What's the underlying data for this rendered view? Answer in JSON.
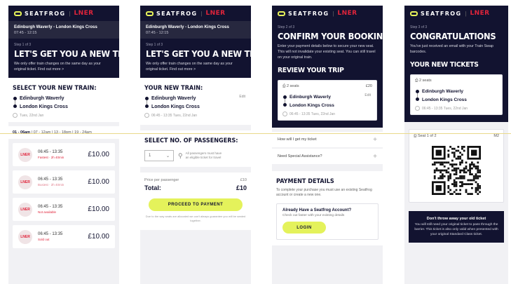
{
  "brand": {
    "name": "SEATFROG",
    "partner": "LNER"
  },
  "colors": {
    "navy": "#121330",
    "accent": "#e4f25b",
    "lner_red": "#e1243b"
  },
  "journey": {
    "route": "Edinburgh Waverly - London Kings Cross",
    "time": "07:45 - 12:15",
    "from": "Edinburgh Waverly",
    "to": "London Kings Cross",
    "date": "Tues, 22nd Jan"
  },
  "screen1": {
    "step": "Step 1 of 3",
    "title": "LET'S GET YOU A NEW TRAIN",
    "subtitle": "We only offer train changes on the same day as your original ticket. Find out more >",
    "select_heading": "SELECT YOUR NEW TRAIN:",
    "time_filters": {
      "active": "01 - 06am",
      "rest": "| 07 - 12am | 13 - 18pm | 19 - 24am"
    },
    "trains": [
      {
        "operator": "LNER",
        "time": "06:45 - 13:35",
        "status": "Fastest · 2h 40min",
        "price": "£10.00"
      },
      {
        "operator": "LNER",
        "time": "06:45 - 13:35",
        "status": "Busiest · 2h 40min",
        "price": "£10.00"
      },
      {
        "operator": "LNER",
        "time": "06:45 - 13:35",
        "status": "Not available",
        "price": "£10.00"
      },
      {
        "operator": "LNER",
        "time": "06:45 - 13:35",
        "status": "Sold out",
        "price": "£10.00"
      }
    ]
  },
  "screen2": {
    "step": "Step 1 of 3",
    "title": "LET'S GET YOU A NEW TRAIN",
    "subtitle": "We only offer train changes on the same day as your original ticket. Find out more >",
    "heading": "YOUR NEW TRAIN:",
    "edit": "Edit",
    "times": "06:45 - 13:35   Tues, 22nd Jan",
    "passengers_heading": "SELECT NO. OF PASSENGERS:",
    "passenger_value": "1",
    "passenger_note": "All passengers must have an eligible ticket for travel",
    "price_label": "Price per passenger",
    "price_value": "£10",
    "total_label": "Total:",
    "total_value": "£10",
    "cta": "PROCEED TO PAYMENT",
    "cta_note": "Due to the way seats are allocated we can't always guarantee you will be seated together."
  },
  "screen3": {
    "step": "Step 2 of 3",
    "title": "CONFIRM YOUR BOOKING",
    "subtitle": "Enter your payment details below to secure your new seat. This will not invalidate your existing seat. You can still travel on your original train.",
    "review_heading": "REVIEW YOUR TRIP",
    "seats": "2 seats",
    "seats_price": "£20",
    "edit": "Edit",
    "times": "06:45 - 13:35   Tues, 22nd Jan",
    "faq1": "How will I get my ticket",
    "faq2": "Need Special Assistance?",
    "payment_heading": "PAYMENT DETAILS",
    "payment_text": "To complete your purchase you must use an existing Seatfrog account or create a new one.",
    "account_q": "Already Have a Seatfrog Account?",
    "account_text": "Check out faster with your existing details",
    "login": "LOGIN"
  },
  "screen4": {
    "step": "Step 3 of 3",
    "title": "CONGRATULATIONS",
    "subtitle": "You've just received an email with your Train Swap barcodes.",
    "tickets_heading": "YOUR NEW TICKETS",
    "seats": "2 seats",
    "times": "06:45 - 13:35   Tues, 22nd Jan",
    "seat_label": "Seat 1 of 2",
    "seat_code": "M2",
    "warn_title": "Don't throw away your old ticket",
    "warn_text": "You will still need your original ticket to pass through the barrier. This ticket is also only valid when presented with your original Standard Class ticket."
  }
}
